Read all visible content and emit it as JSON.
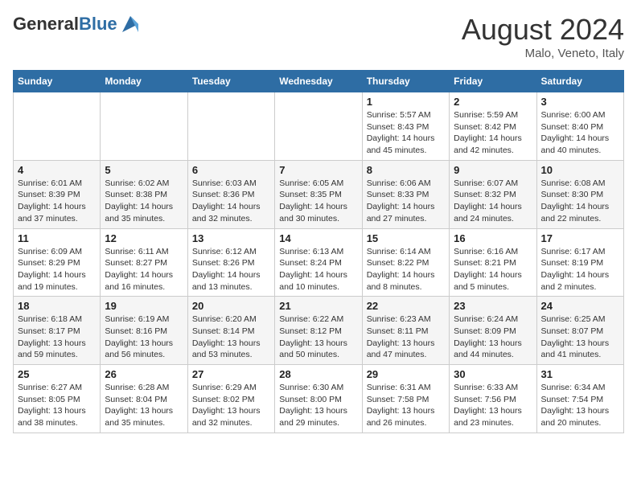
{
  "logo": {
    "general": "General",
    "blue": "Blue"
  },
  "header": {
    "month": "August 2024",
    "location": "Malo, Veneto, Italy"
  },
  "days_of_week": [
    "Sunday",
    "Monday",
    "Tuesday",
    "Wednesday",
    "Thursday",
    "Friday",
    "Saturday"
  ],
  "weeks": [
    [
      {
        "day": "",
        "sunrise": "",
        "sunset": "",
        "daylight": ""
      },
      {
        "day": "",
        "sunrise": "",
        "sunset": "",
        "daylight": ""
      },
      {
        "day": "",
        "sunrise": "",
        "sunset": "",
        "daylight": ""
      },
      {
        "day": "",
        "sunrise": "",
        "sunset": "",
        "daylight": ""
      },
      {
        "day": "1",
        "sunrise": "Sunrise: 5:57 AM",
        "sunset": "Sunset: 8:43 PM",
        "daylight": "Daylight: 14 hours and 45 minutes."
      },
      {
        "day": "2",
        "sunrise": "Sunrise: 5:59 AM",
        "sunset": "Sunset: 8:42 PM",
        "daylight": "Daylight: 14 hours and 42 minutes."
      },
      {
        "day": "3",
        "sunrise": "Sunrise: 6:00 AM",
        "sunset": "Sunset: 8:40 PM",
        "daylight": "Daylight: 14 hours and 40 minutes."
      }
    ],
    [
      {
        "day": "4",
        "sunrise": "Sunrise: 6:01 AM",
        "sunset": "Sunset: 8:39 PM",
        "daylight": "Daylight: 14 hours and 37 minutes."
      },
      {
        "day": "5",
        "sunrise": "Sunrise: 6:02 AM",
        "sunset": "Sunset: 8:38 PM",
        "daylight": "Daylight: 14 hours and 35 minutes."
      },
      {
        "day": "6",
        "sunrise": "Sunrise: 6:03 AM",
        "sunset": "Sunset: 8:36 PM",
        "daylight": "Daylight: 14 hours and 32 minutes."
      },
      {
        "day": "7",
        "sunrise": "Sunrise: 6:05 AM",
        "sunset": "Sunset: 8:35 PM",
        "daylight": "Daylight: 14 hours and 30 minutes."
      },
      {
        "day": "8",
        "sunrise": "Sunrise: 6:06 AM",
        "sunset": "Sunset: 8:33 PM",
        "daylight": "Daylight: 14 hours and 27 minutes."
      },
      {
        "day": "9",
        "sunrise": "Sunrise: 6:07 AM",
        "sunset": "Sunset: 8:32 PM",
        "daylight": "Daylight: 14 hours and 24 minutes."
      },
      {
        "day": "10",
        "sunrise": "Sunrise: 6:08 AM",
        "sunset": "Sunset: 8:30 PM",
        "daylight": "Daylight: 14 hours and 22 minutes."
      }
    ],
    [
      {
        "day": "11",
        "sunrise": "Sunrise: 6:09 AM",
        "sunset": "Sunset: 8:29 PM",
        "daylight": "Daylight: 14 hours and 19 minutes."
      },
      {
        "day": "12",
        "sunrise": "Sunrise: 6:11 AM",
        "sunset": "Sunset: 8:27 PM",
        "daylight": "Daylight: 14 hours and 16 minutes."
      },
      {
        "day": "13",
        "sunrise": "Sunrise: 6:12 AM",
        "sunset": "Sunset: 8:26 PM",
        "daylight": "Daylight: 14 hours and 13 minutes."
      },
      {
        "day": "14",
        "sunrise": "Sunrise: 6:13 AM",
        "sunset": "Sunset: 8:24 PM",
        "daylight": "Daylight: 14 hours and 10 minutes."
      },
      {
        "day": "15",
        "sunrise": "Sunrise: 6:14 AM",
        "sunset": "Sunset: 8:22 PM",
        "daylight": "Daylight: 14 hours and 8 minutes."
      },
      {
        "day": "16",
        "sunrise": "Sunrise: 6:16 AM",
        "sunset": "Sunset: 8:21 PM",
        "daylight": "Daylight: 14 hours and 5 minutes."
      },
      {
        "day": "17",
        "sunrise": "Sunrise: 6:17 AM",
        "sunset": "Sunset: 8:19 PM",
        "daylight": "Daylight: 14 hours and 2 minutes."
      }
    ],
    [
      {
        "day": "18",
        "sunrise": "Sunrise: 6:18 AM",
        "sunset": "Sunset: 8:17 PM",
        "daylight": "Daylight: 13 hours and 59 minutes."
      },
      {
        "day": "19",
        "sunrise": "Sunrise: 6:19 AM",
        "sunset": "Sunset: 8:16 PM",
        "daylight": "Daylight: 13 hours and 56 minutes."
      },
      {
        "day": "20",
        "sunrise": "Sunrise: 6:20 AM",
        "sunset": "Sunset: 8:14 PM",
        "daylight": "Daylight: 13 hours and 53 minutes."
      },
      {
        "day": "21",
        "sunrise": "Sunrise: 6:22 AM",
        "sunset": "Sunset: 8:12 PM",
        "daylight": "Daylight: 13 hours and 50 minutes."
      },
      {
        "day": "22",
        "sunrise": "Sunrise: 6:23 AM",
        "sunset": "Sunset: 8:11 PM",
        "daylight": "Daylight: 13 hours and 47 minutes."
      },
      {
        "day": "23",
        "sunrise": "Sunrise: 6:24 AM",
        "sunset": "Sunset: 8:09 PM",
        "daylight": "Daylight: 13 hours and 44 minutes."
      },
      {
        "day": "24",
        "sunrise": "Sunrise: 6:25 AM",
        "sunset": "Sunset: 8:07 PM",
        "daylight": "Daylight: 13 hours and 41 minutes."
      }
    ],
    [
      {
        "day": "25",
        "sunrise": "Sunrise: 6:27 AM",
        "sunset": "Sunset: 8:05 PM",
        "daylight": "Daylight: 13 hours and 38 minutes."
      },
      {
        "day": "26",
        "sunrise": "Sunrise: 6:28 AM",
        "sunset": "Sunset: 8:04 PM",
        "daylight": "Daylight: 13 hours and 35 minutes."
      },
      {
        "day": "27",
        "sunrise": "Sunrise: 6:29 AM",
        "sunset": "Sunset: 8:02 PM",
        "daylight": "Daylight: 13 hours and 32 minutes."
      },
      {
        "day": "28",
        "sunrise": "Sunrise: 6:30 AM",
        "sunset": "Sunset: 8:00 PM",
        "daylight": "Daylight: 13 hours and 29 minutes."
      },
      {
        "day": "29",
        "sunrise": "Sunrise: 6:31 AM",
        "sunset": "Sunset: 7:58 PM",
        "daylight": "Daylight: 13 hours and 26 minutes."
      },
      {
        "day": "30",
        "sunrise": "Sunrise: 6:33 AM",
        "sunset": "Sunset: 7:56 PM",
        "daylight": "Daylight: 13 hours and 23 minutes."
      },
      {
        "day": "31",
        "sunrise": "Sunrise: 6:34 AM",
        "sunset": "Sunset: 7:54 PM",
        "daylight": "Daylight: 13 hours and 20 minutes."
      }
    ]
  ]
}
